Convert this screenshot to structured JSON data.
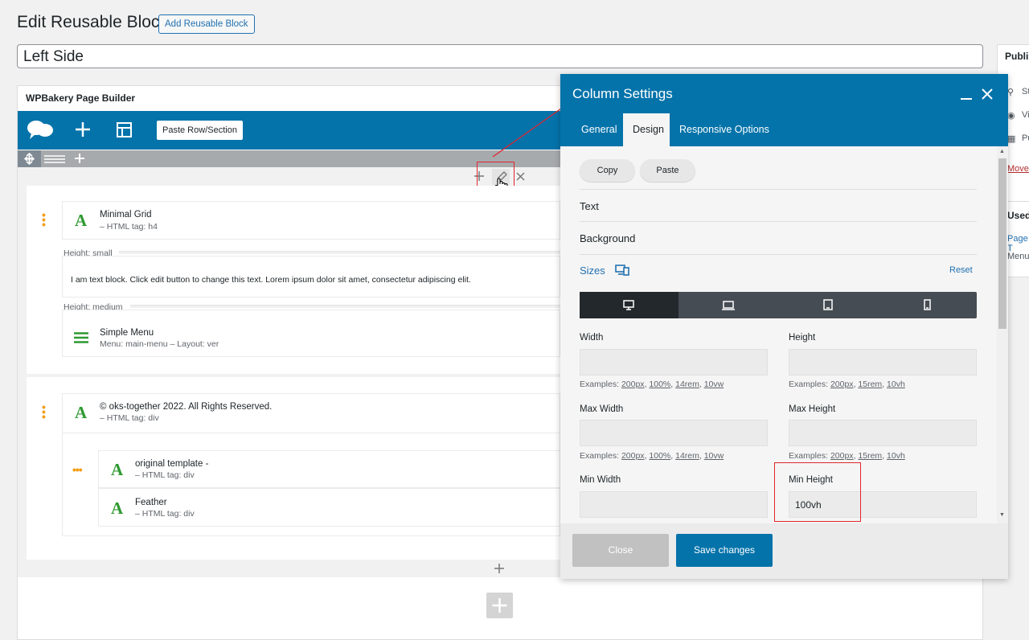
{
  "header": {
    "title": "Edit Reusable Block",
    "add_button": "Add Reusable Block",
    "post_title": "Left Side"
  },
  "sidebar": {
    "publish": "Publis",
    "rows": [
      "St",
      "Vi",
      "Pu"
    ],
    "move": "Move",
    "used": "Used",
    "page": "Page T",
    "menu": "Menu"
  },
  "builder": {
    "title": "WPBakery Page Builder",
    "paste_button": "Paste Row/Section",
    "elements": [
      {
        "title": "Minimal Grid",
        "sub": "– HTML tag: h4"
      },
      {
        "divider": "Height: small"
      },
      {
        "text": "I am text block. Click edit button to change this text. Lorem ipsum dolor sit amet, consectetur adipiscing elit."
      },
      {
        "divider": "Height: medium"
      },
      {
        "title": "Simple Menu",
        "sub": "Menu: main-menu  –  Layout: ver"
      },
      {
        "title": "© oks-together 2022. All Rights Reserved.",
        "sub": "– HTML tag: div"
      },
      {
        "title": "original template -",
        "sub": "– HTML tag: div"
      },
      {
        "title": "Feather",
        "sub": "– HTML tag: div"
      }
    ]
  },
  "modal": {
    "title": "Column Settings",
    "tabs": [
      "General",
      "Design",
      "Responsive Options"
    ],
    "active_tab": "Design",
    "copy": "Copy",
    "paste": "Paste",
    "sections": [
      "Text",
      "Background",
      "Sizes"
    ],
    "reset": "Reset",
    "fields": {
      "width": {
        "label": "Width",
        "value": "",
        "examples_prefix": "Examples:",
        "examples": [
          "200px",
          "100%",
          "14rem",
          "10vw"
        ]
      },
      "height": {
        "label": "Height",
        "value": "",
        "examples_prefix": "Examples:",
        "examples": [
          "200px",
          "15rem",
          "10vh"
        ]
      },
      "max_width": {
        "label": "Max Width",
        "value": "",
        "examples_prefix": "Examples:",
        "examples": [
          "200px",
          "100%",
          "14rem",
          "10vw"
        ]
      },
      "max_height": {
        "label": "Max Height",
        "value": "",
        "examples_prefix": "Examples:",
        "examples": [
          "200px",
          "15rem",
          "10vh"
        ]
      },
      "min_width": {
        "label": "Min Width",
        "value": ""
      },
      "min_height": {
        "label": "Min Height",
        "value": "100vh"
      }
    },
    "close": "Close",
    "save": "Save changes"
  },
  "colors": {
    "accent": "#0473aa",
    "annotation": "#e0262e",
    "element_icon": "#2f9931",
    "handle": "#f39c12"
  }
}
